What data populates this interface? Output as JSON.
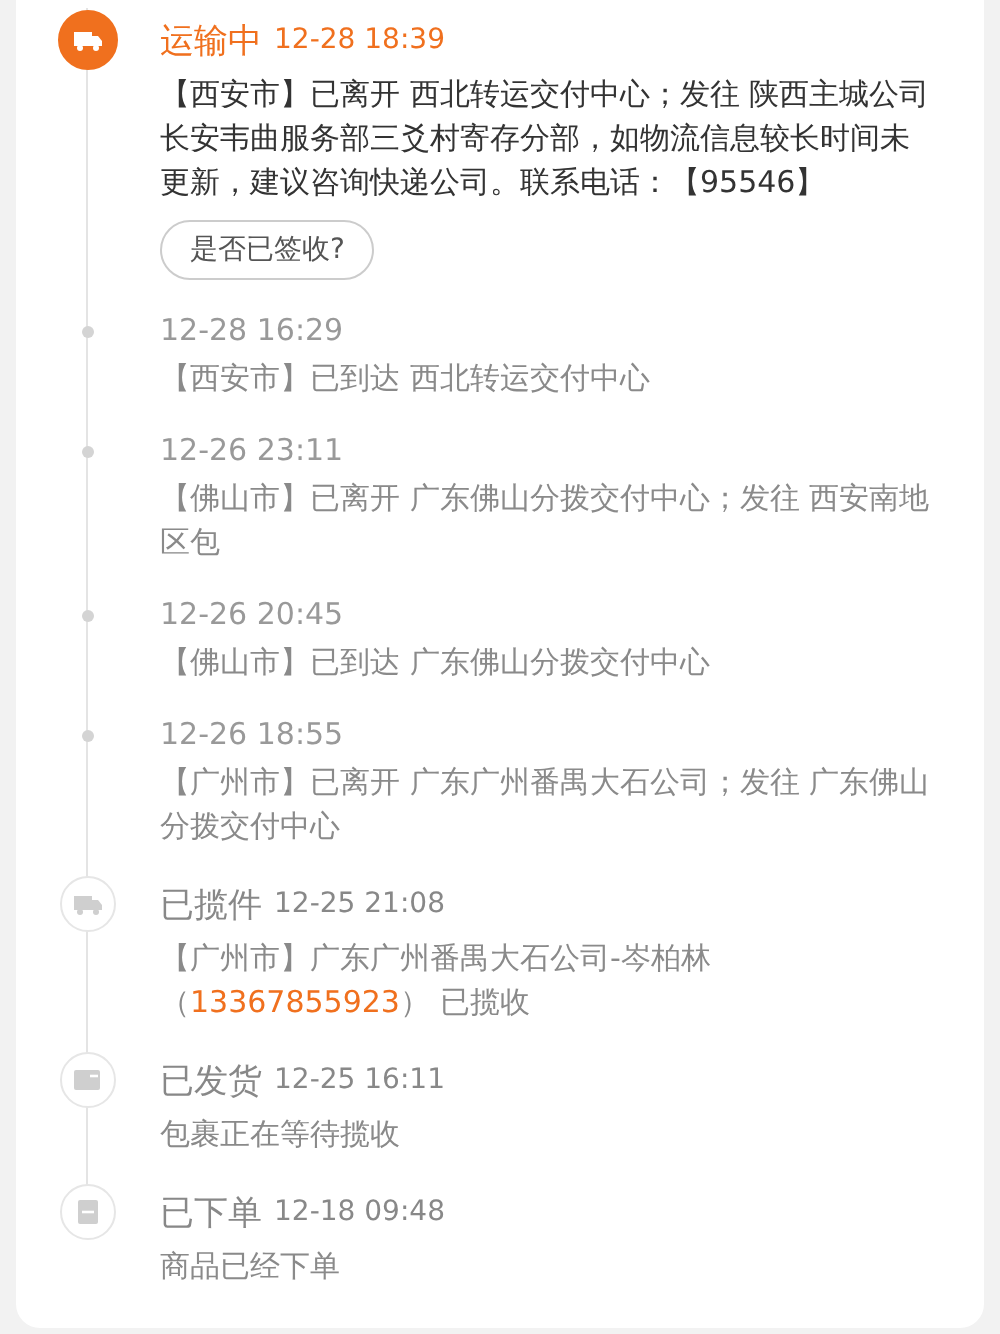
{
  "events": [
    {
      "kind": "transit",
      "active": true,
      "status": "运输中",
      "time": "12-28 18:39",
      "detail": "【西安市】已离开 西北转运交付中心；发往 陕西主城公司长安韦曲服务部三爻村寄存分部，如物流信息较长时间未更新，建议咨询快递公司。联系电话：【95546】",
      "action": "是否已签收?"
    },
    {
      "kind": "step",
      "active": false,
      "time": "12-28 16:29",
      "detail": "【西安市】已到达 西北转运交付中心"
    },
    {
      "kind": "step",
      "active": false,
      "time": "12-26 23:11",
      "detail": "【佛山市】已离开 广东佛山分拨交付中心；发往 西安南地区包"
    },
    {
      "kind": "step",
      "active": false,
      "time": "12-26 20:45",
      "detail": "【佛山市】已到达 广东佛山分拨交付中心"
    },
    {
      "kind": "step",
      "active": false,
      "time": "12-26 18:55",
      "detail": "【广州市】已离开 广东广州番禺大石公司；发往 广东佛山分拨交付中心"
    },
    {
      "kind": "pickup",
      "active": false,
      "status": "已揽件",
      "time": "12-25 21:08",
      "detail": "【广州市】广东广州番禺大石公司-岑柏林（",
      "phone": "13367855923",
      "detail_end": "） 已揽收"
    },
    {
      "kind": "shipped",
      "active": false,
      "status": "已发货",
      "time": "12-25 16:11",
      "detail": "包裹正在等待揽收"
    },
    {
      "kind": "ordered",
      "active": false,
      "status": "已下单",
      "time": "12-18 09:48",
      "detail": "商品已经下单"
    }
  ]
}
